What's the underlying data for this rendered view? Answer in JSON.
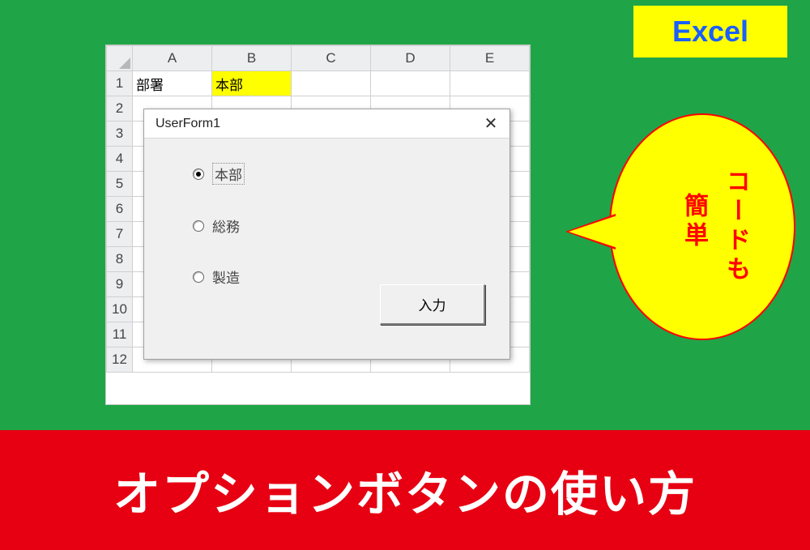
{
  "badge": {
    "label": "Excel"
  },
  "bubble": {
    "line1": "コードも",
    "line2": "簡単"
  },
  "sheet": {
    "columns": [
      "A",
      "B",
      "C",
      "D",
      "E"
    ],
    "rows": [
      "1",
      "2",
      "3",
      "4",
      "5",
      "6",
      "7",
      "8",
      "9",
      "10",
      "11",
      "12"
    ],
    "a1": "部署",
    "b1": "本部"
  },
  "userform": {
    "title": "UserForm1",
    "close": "✕",
    "options": [
      {
        "label": "本部",
        "checked": true,
        "focused": true
      },
      {
        "label": "総務",
        "checked": false,
        "focused": false
      },
      {
        "label": "製造",
        "checked": false,
        "focused": false
      }
    ],
    "button": "入力"
  },
  "banner": {
    "text": "オプションボタンの使い方"
  }
}
